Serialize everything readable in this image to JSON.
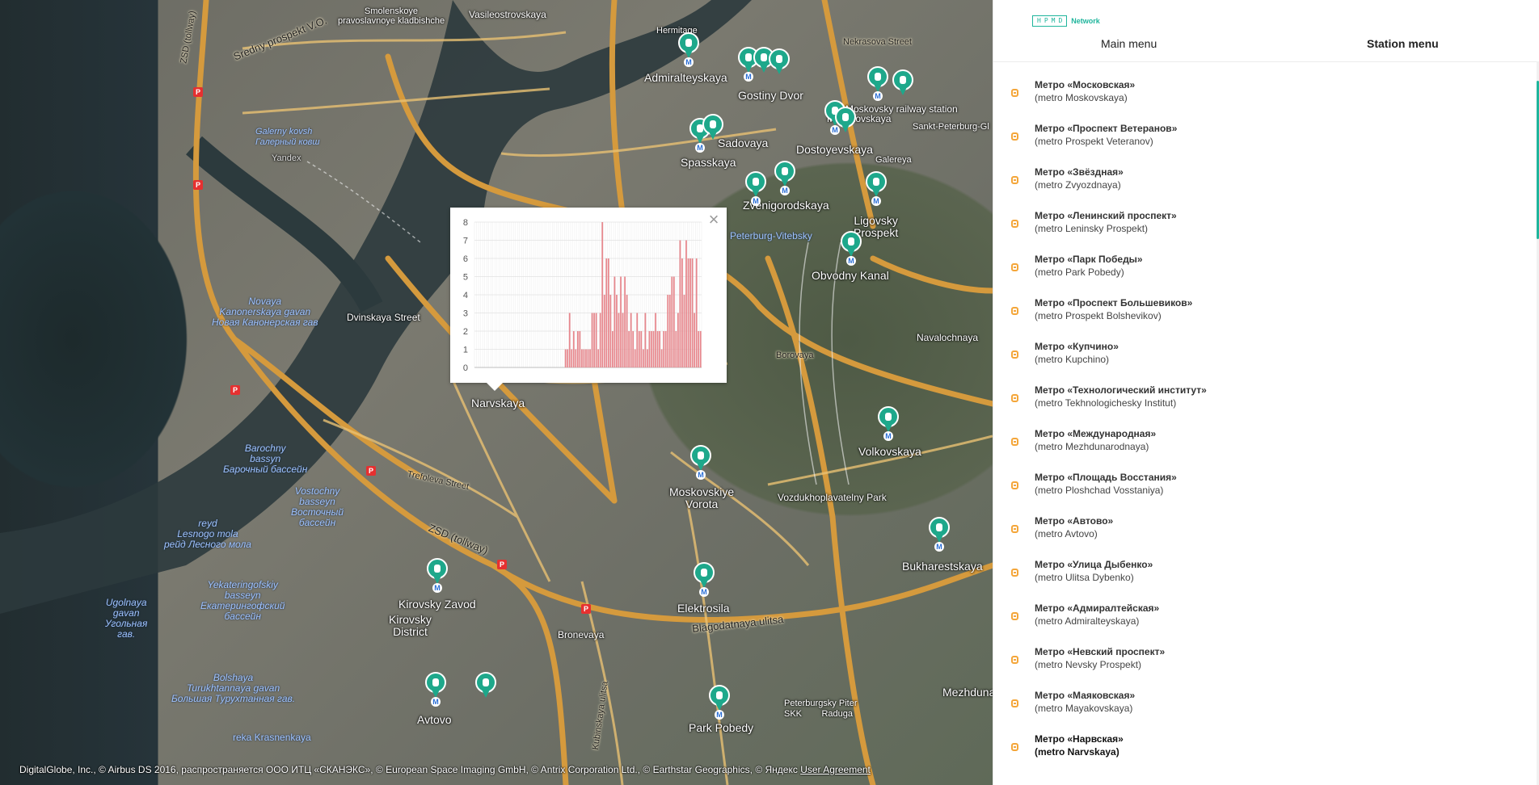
{
  "map": {
    "labels": {
      "smolenskoye": "Smolenskoye\npravoslavnoye kladbishche",
      "vasileostrovskaya": "Vasileostrovskaya",
      "hermitage": "Hermitage",
      "nekrasova": "Nekrasova Street",
      "sredny": "Sredny prospekt V.O.",
      "zsd_toll": "ZSD (tollway)",
      "admiralteyskaya": "Admiralteyskaya",
      "gostiny": "Gostiny Dvor",
      "moskovsky_rs": "Moskovsky railway station",
      "mayakovskaya_short": "Mayakovskaya",
      "sankt": "Sankt-Peterburg-Gl",
      "galerny": "Galerny kovsh\nГалерный ковш",
      "yandex": "Yandex",
      "sadovaya": "Sadovaya",
      "spasskaya": "Spasskaya",
      "dostoyevskaya": "Dostoyevskaya",
      "galereya": "Galereya",
      "zvenigorodskaya": "Zvenigorodskaya",
      "ligovsky": "Ligovsky\nProspekt",
      "vitebsky": "Peterburg-Vitebsky",
      "obvodny": "Obvodny Kanal",
      "novaya": "Novaya\nKanonerskaya gavan\nНовая Канонерская гав",
      "dvinskaya": "Dvinskaya Street",
      "navalochnaya": "Navalochnaya",
      "narvskaya": "Narvskaya",
      "borovaya": "Borovaya",
      "barochny": "Barochny\nbassyn\nБарочный бассейн",
      "vostochny": "Vostochny\nbasseyn\nВосточный\nбассейн",
      "trefoleva": "Trefoleva Street",
      "volkovskaya": "Volkovskaya",
      "moskovskiye": "Moskovskiye\nVorota",
      "vozdukh": "Vozdukhoplavatelny Park",
      "reyd": "reyd\nLesnogo mola\nрейд Лесного мола",
      "zsd_toll2": "ZSD (tollway)",
      "bukharestskaya": "Bukharestskaya",
      "ugolnaya": "Ugolnaya\ngavan\nУгольная\nгав.",
      "yekaterin": "Yekateringofskiy\nbasseyn\nЕкатерингофский\nбассейн",
      "kirovsky_z": "Kirovsky Zavod",
      "kirovsky_d": "Kirovsky\nDistrict",
      "elektrosila": "Elektrosila",
      "bronevaya": "Bronevaya",
      "blagodatnaya": "Blagodatnaya ulitsa",
      "bolshaya": "Bolshaya\nTurukhtannaya gavan\nБольшая Турухтанная гав.",
      "avtovo": "Avtovo",
      "park_pobedy": "Park Pobedy",
      "peterburgsky": "Peterburgsky Piter\nSKK        Raduga",
      "mezhduna": "Mezhduna",
      "krasnenkaya": "reka Krasnenkaya",
      "kubinskaya": "Kubinskaya ulitsa"
    }
  },
  "popup": {
    "close_icon": "close-icon",
    "chart_data": {
      "type": "bar",
      "title": "",
      "xlabel": "",
      "ylabel": "",
      "ylim": [
        0,
        8
      ],
      "yticks": [
        "0",
        "1",
        "2",
        "3",
        "4",
        "5",
        "6",
        "7",
        "8"
      ],
      "bar_color": "#e8878d",
      "values": [
        0,
        0,
        0,
        0,
        0,
        0,
        0,
        0,
        0,
        0,
        0,
        0,
        0,
        0,
        0,
        0,
        0,
        0,
        0,
        0,
        0,
        0,
        0,
        0,
        0,
        0,
        0,
        0,
        0,
        0,
        0,
        0,
        0,
        0,
        0,
        0,
        0,
        0,
        0,
        0,
        0,
        0,
        0,
        0,
        1,
        1,
        3,
        1,
        2,
        1,
        2,
        2,
        1,
        1,
        1,
        1,
        1,
        3,
        3,
        3,
        1,
        3,
        8,
        4,
        6,
        6,
        4,
        2,
        5,
        4,
        3,
        5,
        3,
        5,
        4,
        2,
        3,
        2,
        1,
        3,
        2,
        2,
        1,
        3,
        1,
        2,
        2,
        2,
        3,
        2,
        2,
        1,
        2,
        2,
        4,
        4,
        5,
        5,
        2,
        3,
        7,
        6,
        4,
        7,
        6,
        6,
        6,
        3,
        6,
        2,
        2
      ]
    }
  },
  "panel": {
    "logo_mark": "HPMD",
    "logo_text": "Network",
    "tabs": {
      "main": "Main menu",
      "station": "Station menu"
    },
    "stations": [
      {
        "ru": "Метро «Московская»",
        "en": "(metro Moskovskaya)"
      },
      {
        "ru": "Метро «Проспект Ветеранов»",
        "en": "(metro Prospekt Veteranov)"
      },
      {
        "ru": "Метро «Звёздная»",
        "en": "(metro Zvyozdnaya)"
      },
      {
        "ru": "Метро «Ленинский проспект»",
        "en": "(metro Leninsky Prospekt)"
      },
      {
        "ru": "Метро «Парк Победы»",
        "en": "(metro Park Pobedy)"
      },
      {
        "ru": "Метро «Проспект Большевиков»",
        "en": "(metro Prospekt Bolshevikov)"
      },
      {
        "ru": "Метро «Купчино»",
        "en": "(metro Kupchino)"
      },
      {
        "ru": "Метро «Технологический институт»",
        "en": "(metro Tekhnologichesky Institut)"
      },
      {
        "ru": "Метро «Международная»",
        "en": "(metro Mezhdunarodnaya)"
      },
      {
        "ru": "Метро «Площадь Восстания»",
        "en": "(metro Ploshchad Vosstaniya)"
      },
      {
        "ru": "Метро «Автово»",
        "en": "(metro Avtovo)"
      },
      {
        "ru": "Метро «Улица Дыбенко»",
        "en": "(metro Ulitsa Dybenko)"
      },
      {
        "ru": "Метро «Адмиралтейская»",
        "en": "(metro Admiralteyskaya)"
      },
      {
        "ru": "Метро «Невский проспект»",
        "en": "(metro Nevsky Prospekt)"
      },
      {
        "ru": "Метро «Маяковская»",
        "en": "(metro Mayakovskaya)"
      },
      {
        "ru": "Метро «Нарвская»",
        "en": "(metro Narvskaya)"
      }
    ]
  },
  "attribution": {
    "text": "DigitalGlobe, Inc., © Airbus DS 2016, распространяется ООО ИТЦ «СКАНЭКС», © European Space Imaging GmbH, © Antrix Corporation Ltd., © Earthstar Geographics, © Яндекс",
    "link": "User Agreement"
  },
  "colors": {
    "accent": "#1fb59c",
    "pin": "#1ea88b",
    "station_icon": "#f4a63a"
  }
}
